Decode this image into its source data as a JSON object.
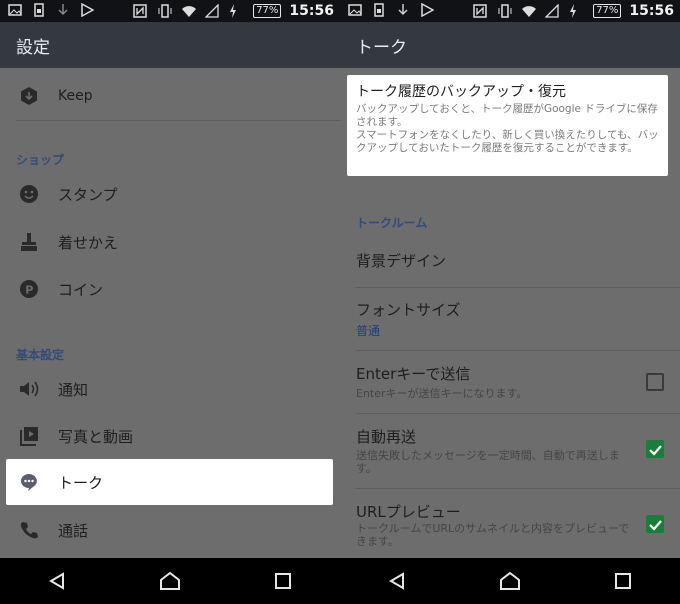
{
  "status": {
    "battery": "77%",
    "time": "15:56"
  },
  "left": {
    "title": "設定",
    "items": {
      "keep": "Keep",
      "section_shop": "ショップ",
      "stamp": "スタンプ",
      "themes": "着せかえ",
      "coin": "コイン",
      "section_basic": "基本設定",
      "notify": "通知",
      "photo": "写真と動画",
      "talk": "トーク",
      "call": "通話"
    }
  },
  "right": {
    "title": "トーク",
    "tip": {
      "title": "トーク履歴のバックアップ・復元",
      "desc1": "バックアップしておくと、トーク履歴がGoogle ドライブに保存されます。",
      "desc2": "スマートフォンをなくしたり、新しく買い換えたりしても、バックアップしておいたトーク履歴を復元することができます。"
    },
    "section_room": "トークルーム",
    "background": "背景デザイン",
    "font_size": {
      "label": "フォントサイズ",
      "value": "普通"
    },
    "enter_send": {
      "label": "Enterキーで送信",
      "desc": "Enterキーが送信キーになります。",
      "checked": false
    },
    "auto_resend": {
      "label": "自動再送",
      "desc": "送信失敗したメッセージを一定時間、自動で再送します。",
      "checked": true
    },
    "url_preview": {
      "label": "URLプレビュー",
      "desc": "トークルームでURLのサムネイルと内容をプレビューできます。",
      "checked": true
    }
  }
}
